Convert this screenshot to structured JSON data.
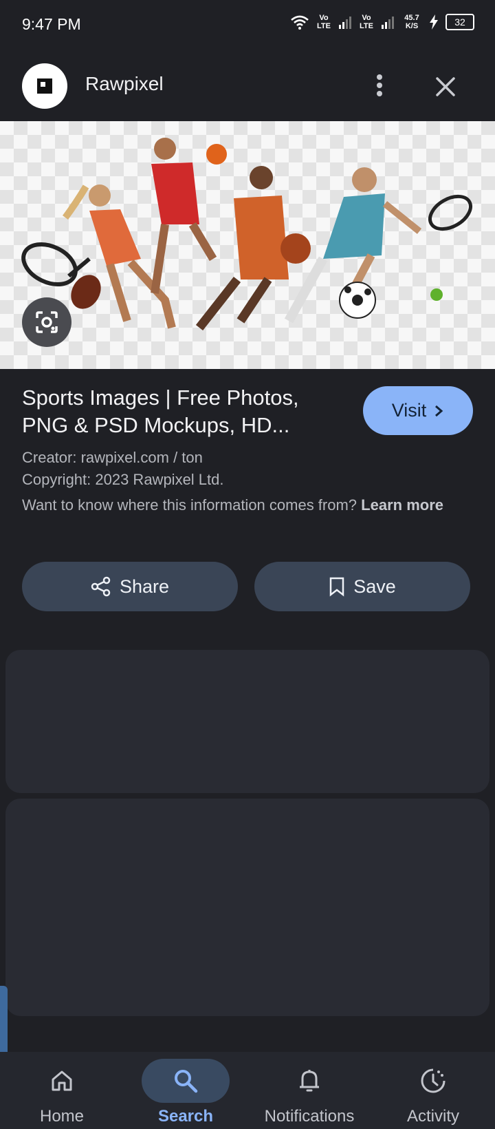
{
  "status": {
    "time": "9:47 PM",
    "network1": "Vo LTE",
    "network2": "Vo LTE",
    "speed": "45.7 K/S",
    "battery": "32"
  },
  "header": {
    "site_name": "Rawpixel",
    "more_icon": "more-vert-icon",
    "close_icon": "close-icon"
  },
  "result": {
    "title": "Sports Images | Free Photos, PNG & PSD Mockups, HD...",
    "visit_label": "Visit",
    "creator": "Creator: rawpixel.com / ton",
    "copyright": "Copyright: 2023 Rawpixel Ltd.",
    "info_text": "Want to know where this information comes from?",
    "learn_more": "Learn more",
    "share_label": "Share",
    "save_label": "Save"
  },
  "nav": {
    "items": [
      {
        "label": "Home",
        "icon": "home-icon"
      },
      {
        "label": "Search",
        "icon": "search-icon",
        "active": true
      },
      {
        "label": "Notifications",
        "icon": "bell-icon"
      },
      {
        "label": "Activity",
        "icon": "activity-icon"
      }
    ]
  },
  "colors": {
    "background": "#1f2025",
    "accent": "#8ab4f8",
    "action_button": "#3a4556",
    "card": "#292b33"
  }
}
